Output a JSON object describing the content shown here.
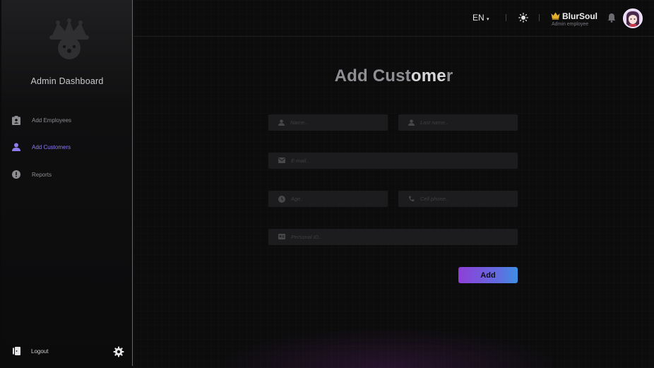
{
  "sidebar": {
    "brand": "Admin Dashboard",
    "logo_icon": "jester-icon",
    "items": [
      {
        "label": "Add Employees",
        "icon": "clipboard-user-icon"
      },
      {
        "label": "Add Customers",
        "icon": "person-icon",
        "active": true
      },
      {
        "label": "Reports",
        "icon": "alert-circle-icon"
      }
    ],
    "logout_label": "Logout"
  },
  "header": {
    "language": "EN",
    "language_caret": "▾",
    "user": {
      "name": "BlurSoul",
      "role": "Admin employee"
    }
  },
  "form": {
    "title_part1": "Add Cust",
    "title_part2": "ome",
    "title_part3": "r",
    "placeholders": {
      "name": "Name..",
      "last_name": "Last name..",
      "email": "E-mail..",
      "age": "Age..",
      "cell_phone": "Cell phone..",
      "personal_id": "Personal ID.."
    },
    "submit_label": "Add"
  },
  "colors": {
    "accent": "#6d4fd3",
    "active_nav": "#8c7cf0",
    "crown": "#e5b02b",
    "button_gradient": [
      "#8e3fd8",
      "#3e8fe3"
    ]
  }
}
